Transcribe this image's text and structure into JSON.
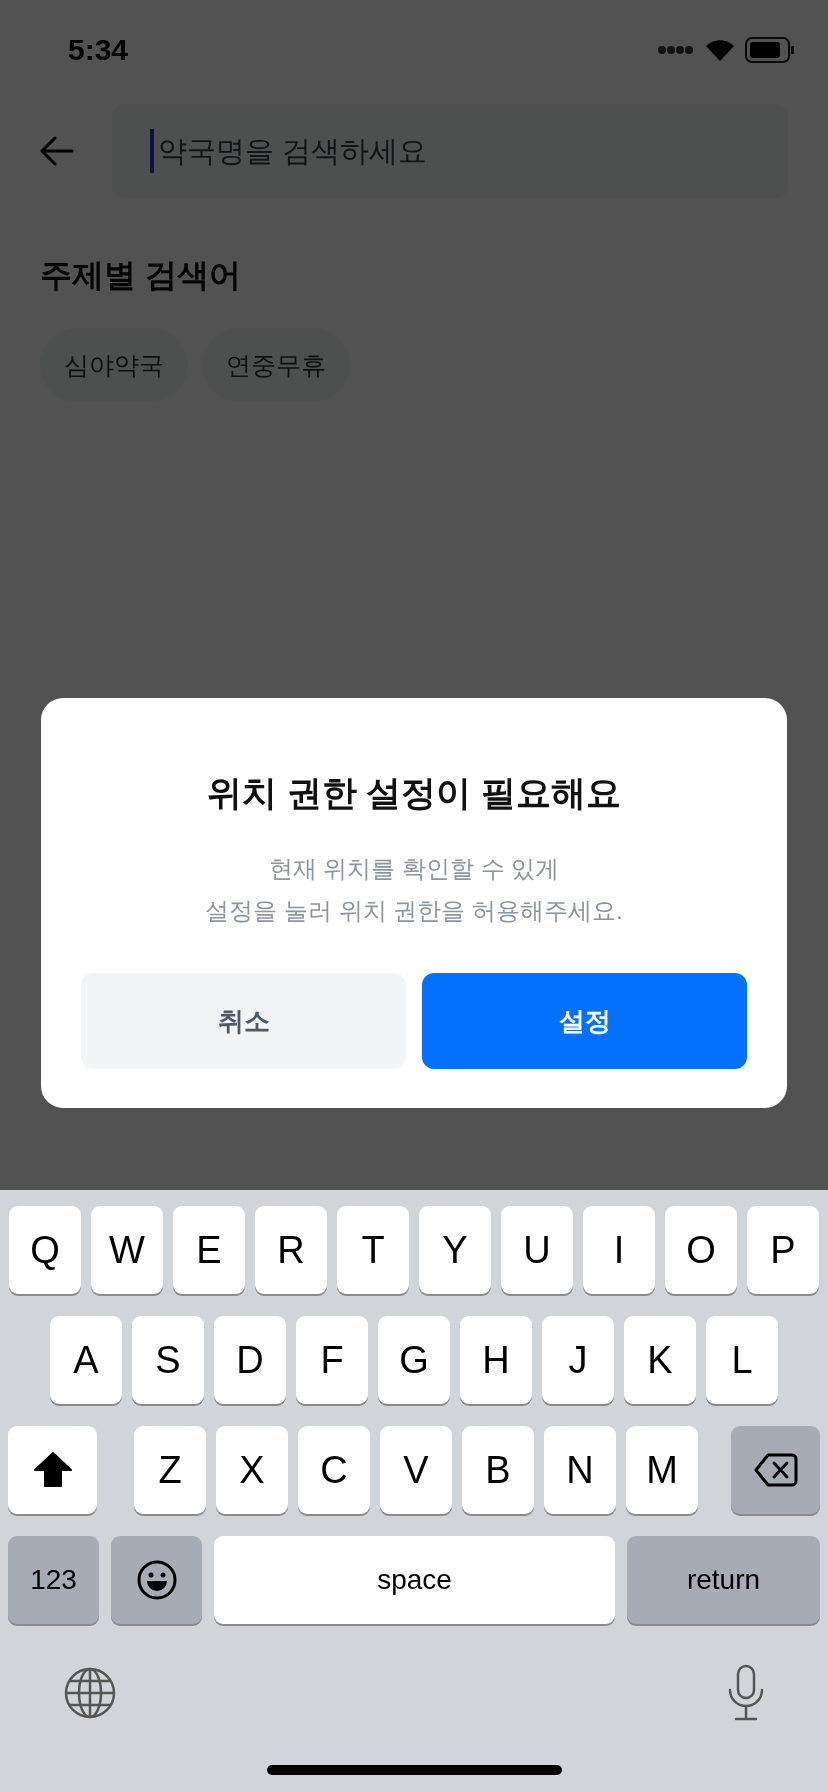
{
  "status_bar": {
    "time": "5:34"
  },
  "search": {
    "placeholder": "약국명을 검색하세요"
  },
  "topic_section": {
    "title": "주제별 검색어",
    "chips": [
      "심야약국",
      "연중무휴"
    ]
  },
  "dialog": {
    "title": "위치 권한 설정이 필요해요",
    "message_lines": [
      "현재 위치를 확인할 수 있게",
      "설정을 눌러 위치 권한을 허용해주세요."
    ],
    "buttons": [
      {
        "label": "취소",
        "kind": "secondary"
      },
      {
        "label": "설정",
        "kind": "primary"
      }
    ]
  },
  "keyboard": {
    "key_rows": [
      {
        "keys": [
          {
            "kind": "letter",
            "label": "Q"
          },
          {
            "kind": "letter",
            "label": "W"
          },
          {
            "kind": "letter",
            "label": "E"
          },
          {
            "kind": "letter",
            "label": "R"
          },
          {
            "kind": "letter",
            "label": "T"
          },
          {
            "kind": "letter",
            "label": "Y"
          },
          {
            "kind": "letter",
            "label": "U"
          },
          {
            "kind": "letter",
            "label": "I"
          },
          {
            "kind": "letter",
            "label": "O"
          },
          {
            "kind": "letter",
            "label": "P"
          }
        ]
      },
      {
        "keys": [
          {
            "kind": "letter",
            "label": "A"
          },
          {
            "kind": "letter",
            "label": "S"
          },
          {
            "kind": "letter",
            "label": "D"
          },
          {
            "kind": "letter",
            "label": "F"
          },
          {
            "kind": "letter",
            "label": "G"
          },
          {
            "kind": "letter",
            "label": "H"
          },
          {
            "kind": "letter",
            "label": "J"
          },
          {
            "kind": "letter",
            "label": "K"
          },
          {
            "kind": "letter",
            "label": "L"
          }
        ]
      },
      {
        "keys": [
          {
            "kind": "shift"
          },
          {
            "kind": "letter",
            "label": "Z"
          },
          {
            "kind": "letter",
            "label": "X"
          },
          {
            "kind": "letter",
            "label": "C"
          },
          {
            "kind": "letter",
            "label": "V"
          },
          {
            "kind": "letter",
            "label": "B"
          },
          {
            "kind": "letter",
            "label": "N"
          },
          {
            "kind": "letter",
            "label": "M"
          },
          {
            "kind": "delete"
          }
        ]
      },
      {
        "keys": [
          {
            "kind": "mode",
            "label": "123"
          },
          {
            "kind": "emoji"
          },
          {
            "kind": "space",
            "label": "space"
          },
          {
            "kind": "return",
            "label": "return"
          }
        ]
      }
    ],
    "bottom_row": [
      {
        "kind": "globe"
      },
      {
        "kind": "mic"
      }
    ]
  }
}
